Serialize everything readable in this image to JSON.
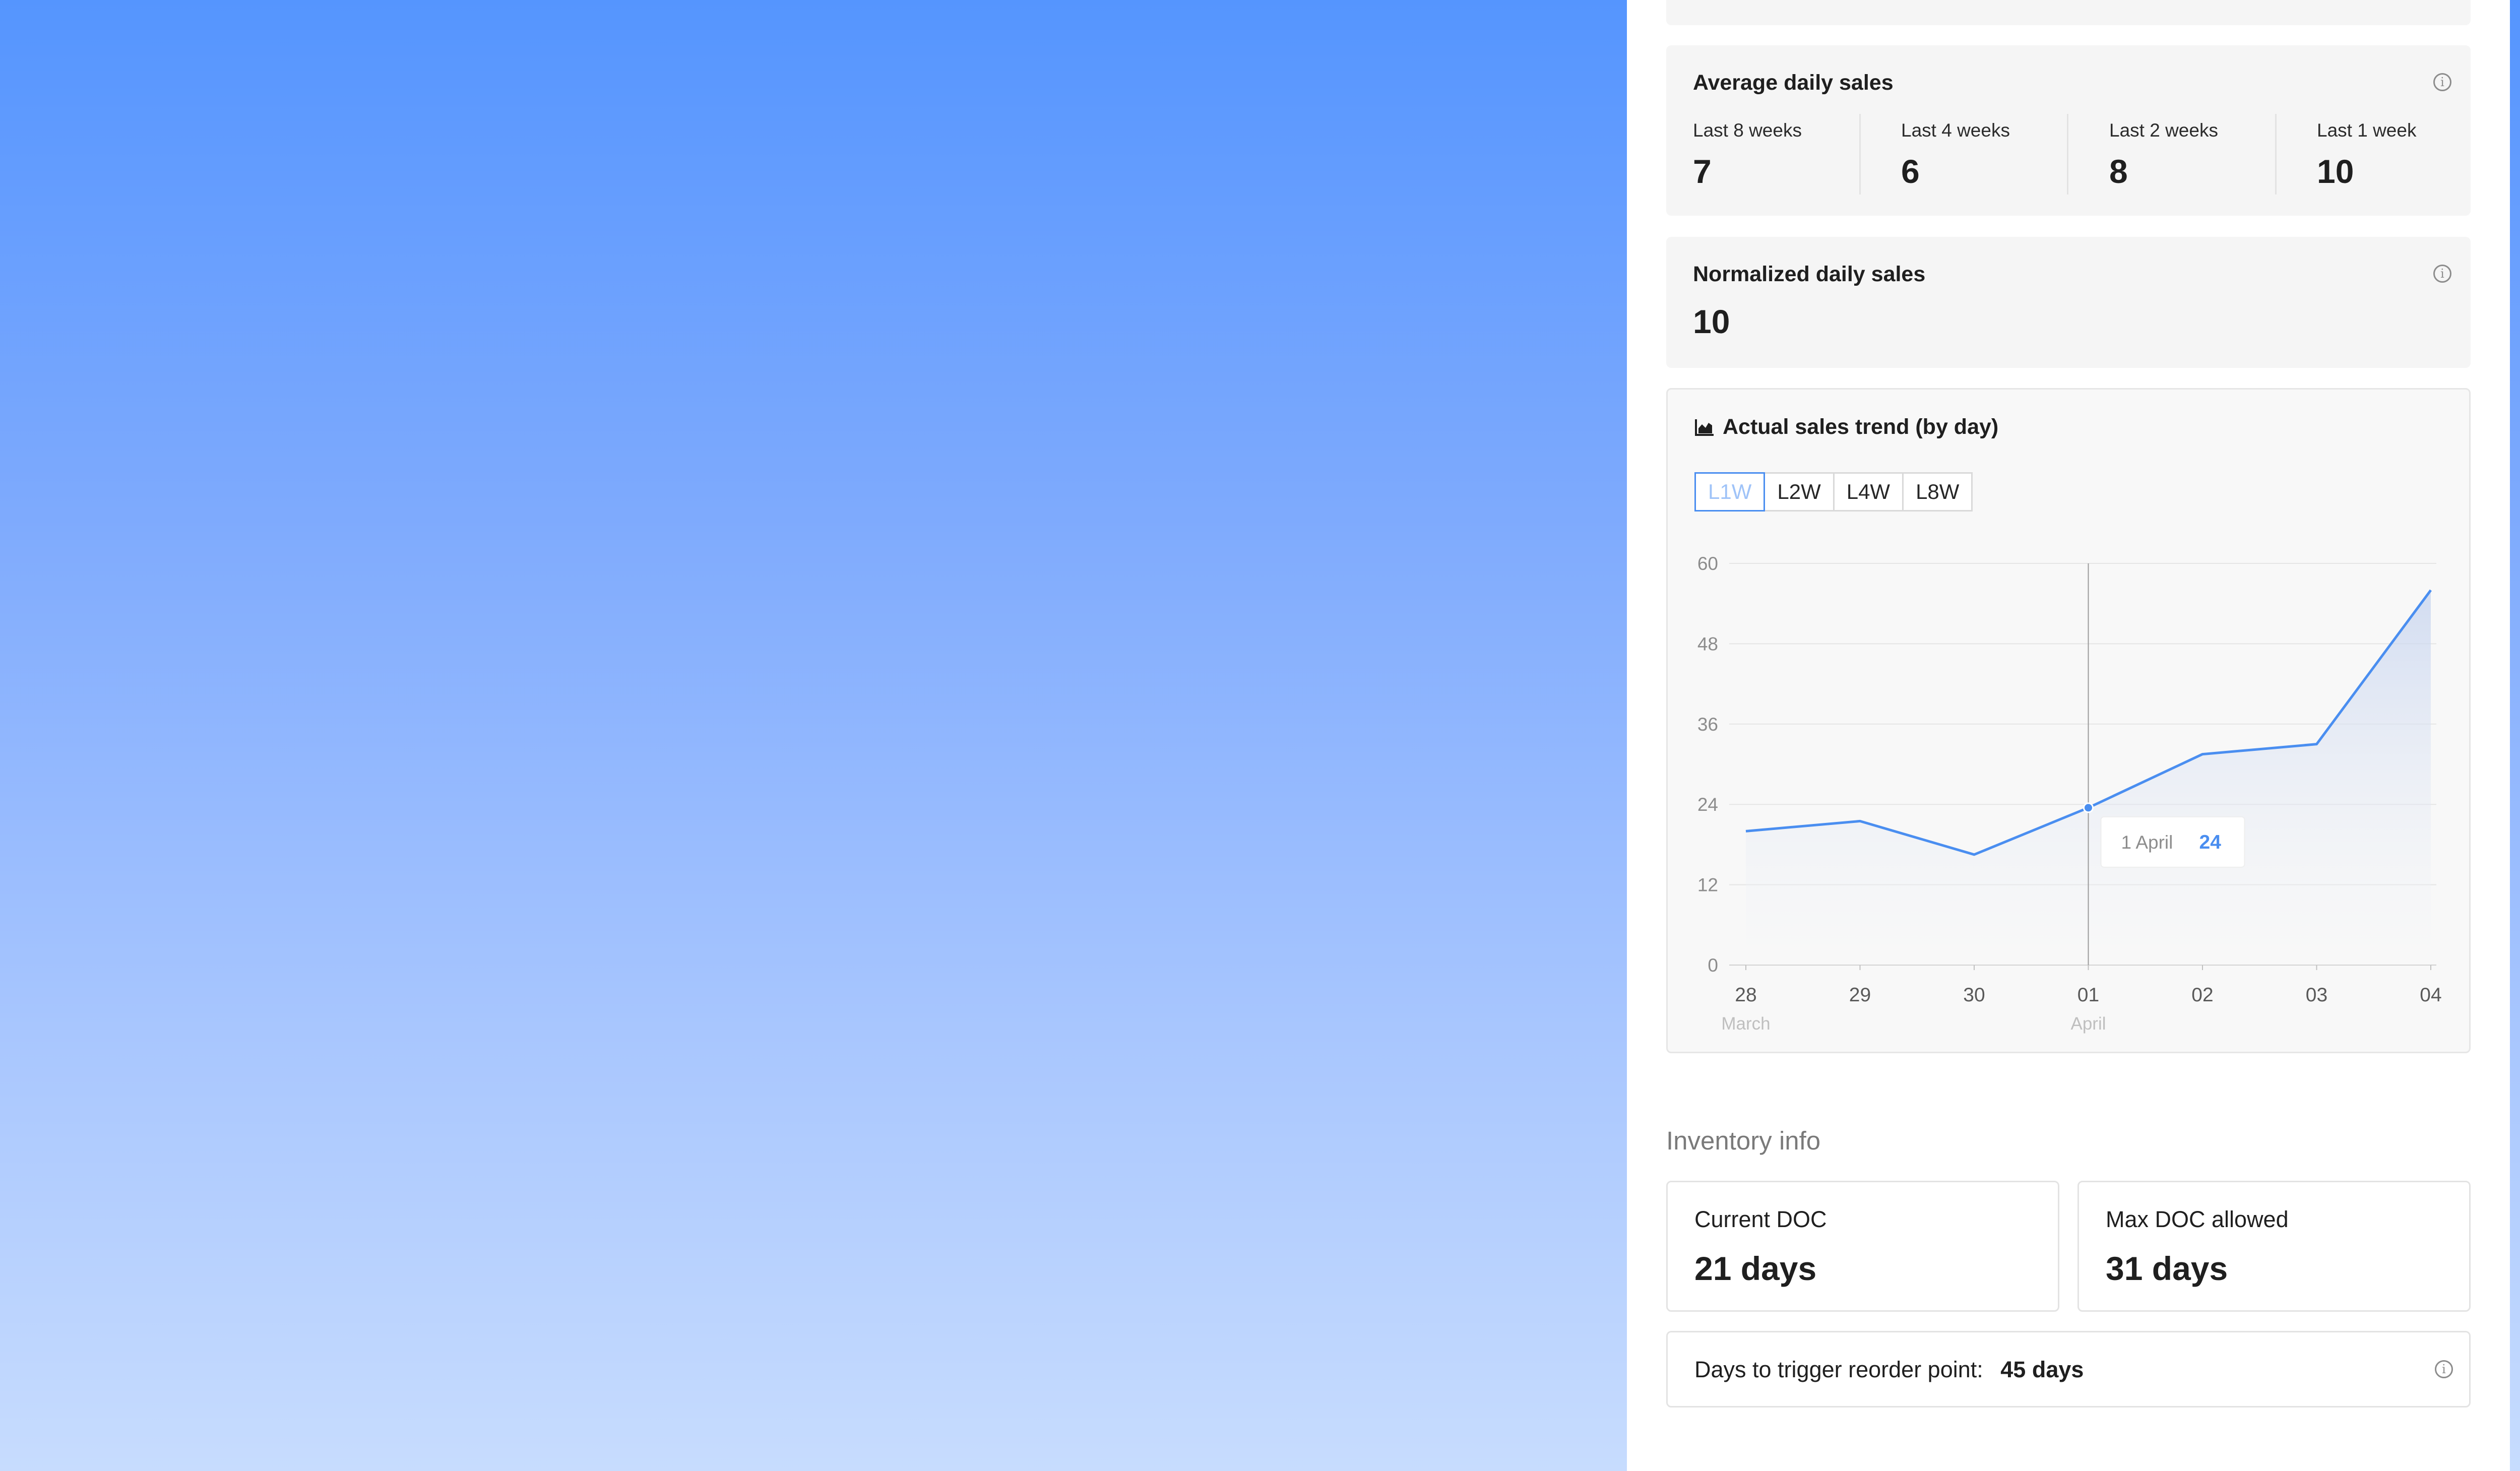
{
  "avg_daily_sales": {
    "title": "Average daily sales",
    "metrics": [
      {
        "label": "Last 8 weeks",
        "value": "7"
      },
      {
        "label": "Last 4 weeks",
        "value": "6"
      },
      {
        "label": "Last 2 weeks",
        "value": "8"
      },
      {
        "label": "Last 1 week",
        "value": "10"
      }
    ]
  },
  "normalized_daily_sales": {
    "title": "Normalized daily sales",
    "value": "10"
  },
  "trend": {
    "title": "Actual sales trend (by day)",
    "icon": "area-chart-icon",
    "tabs": [
      "L1W",
      "L2W",
      "L4W",
      "L8W"
    ],
    "active_tab": "L1W",
    "tooltip": {
      "label": "1 April",
      "value": "24"
    }
  },
  "chart_data": {
    "type": "area",
    "title": "Actual sales trend (by day)",
    "x": [
      "28",
      "29",
      "30",
      "01",
      "02",
      "03",
      "04"
    ],
    "x_sublabels": [
      "March",
      "",
      "",
      "April",
      "",
      "",
      ""
    ],
    "series": [
      {
        "values": [
          20,
          21.5,
          16.5,
          23.5,
          31.5,
          33,
          56
        ]
      }
    ],
    "ylim": [
      0,
      60
    ],
    "yticks": [
      0,
      12,
      24,
      36,
      48,
      60
    ],
    "grid": true,
    "highlight_index": 3,
    "colors": {
      "line": "#4a8ef0",
      "grid": "#e5e5e5"
    }
  },
  "inventory": {
    "section_title": "Inventory info",
    "current_doc": {
      "label": "Current DOC",
      "value": "21 days"
    },
    "max_doc": {
      "label": "Max DOC allowed",
      "value": "31 days"
    },
    "reorder": {
      "label": "Days to trigger reorder point:",
      "value": "45 days"
    }
  }
}
